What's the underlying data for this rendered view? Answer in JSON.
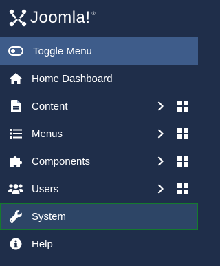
{
  "brand": {
    "name": "Joomla!",
    "registered": "®"
  },
  "toggle": {
    "label": "Toggle Menu"
  },
  "menu": {
    "items": [
      {
        "label": "Home Dashboard",
        "icon": "home-icon"
      },
      {
        "label": "Content",
        "icon": "file-icon"
      },
      {
        "label": "Menus",
        "icon": "list-icon"
      },
      {
        "label": "Components",
        "icon": "puzzle-icon"
      },
      {
        "label": "Users",
        "icon": "users-icon"
      },
      {
        "label": "System",
        "icon": "wrench-icon"
      },
      {
        "label": "Help",
        "icon": "info-icon"
      }
    ]
  },
  "colors": {
    "sidebar_bg": "#1f2e4a",
    "toggle_bg": "#3e5c8a",
    "active_bg": "#2d4566",
    "active_border": "#157a2e"
  }
}
